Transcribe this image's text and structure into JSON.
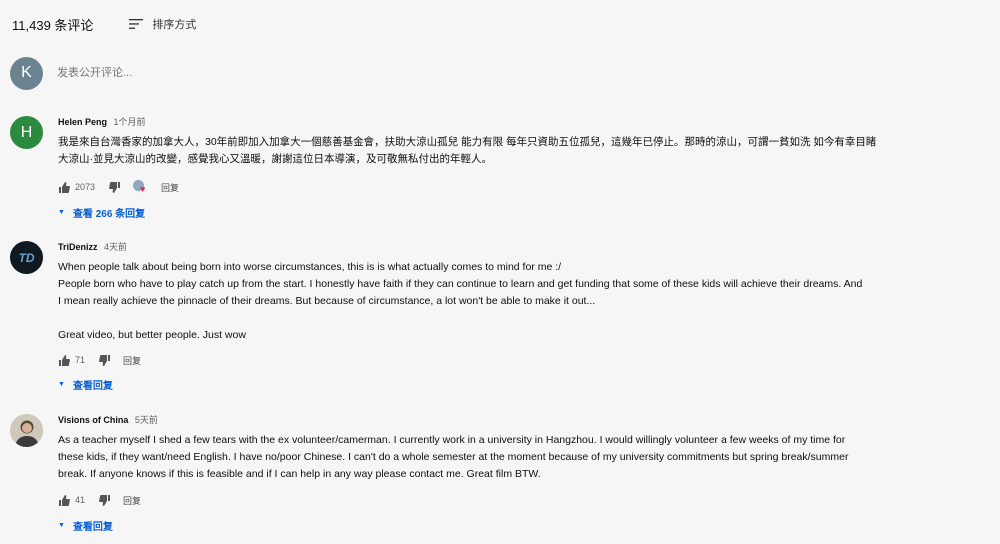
{
  "header": {
    "comment_count": "11,439 条评论",
    "sort_label": "排序方式"
  },
  "add_comment": {
    "avatar_letter": "K",
    "placeholder": "发表公开评论..."
  },
  "comments": [
    {
      "avatar_letter": "H",
      "author": "Helen Peng",
      "time": "1个月前",
      "text": "我是來自台灣香家的加拿大人，30年前即加入加拿大一個慈善基金會，扶助大涼山孤兒 能力有限 每年只資助五位孤兒，這幾年已停止。那時的涼山，可謂一貧如洗 如今有幸目睹\n大涼山·並見大涼山的改變，感覺我心又溫暖，謝謝這位日本導演，及可敬無私付出的年輕人。",
      "likes": "2073",
      "reply_label": "回复",
      "replies_label": "查看 266 条回复"
    },
    {
      "avatar_letter": "TD",
      "author": "TriDenizz",
      "time": "4天前",
      "text": "When people talk about being born into worse circumstances, this is is what actually comes to mind for me :/\nPeople born who have to play catch up from the start. I honestly have faith if they can continue to learn and get funding that some of these kids will achieve their dreams. And\nI mean really achieve the pinnacle of their dreams. But because of circumstance, a lot won't be able to make it out...\n\nGreat video, but better people. Just wow",
      "likes": "71",
      "reply_label": "回复",
      "replies_label": "查看回复"
    },
    {
      "avatar_letter": "",
      "author": "Visions of China",
      "time": "5天前",
      "text": "As a teacher myself I shed a few tears with the ex volunteer/camerman. I currently work in a university in Hangzhou. I would willingly volunteer a few weeks of my time for\nthese kids, if they want/need English. I have no/poor Chinese. I can't do a whole semester at the moment because of my university commitments but spring break/summer\nbreak. If anyone knows if this is feasible and if I can help in any way please contact me.  Great film BTW.",
      "likes": "41",
      "reply_label": "回复",
      "replies_label": "查看回复"
    }
  ],
  "colors": {
    "background": "#f6f6f6",
    "link_blue": "#065fd4",
    "avatar_k": "#6b8391",
    "avatar_h": "#2a8a3e",
    "heart": "#e0245e"
  }
}
